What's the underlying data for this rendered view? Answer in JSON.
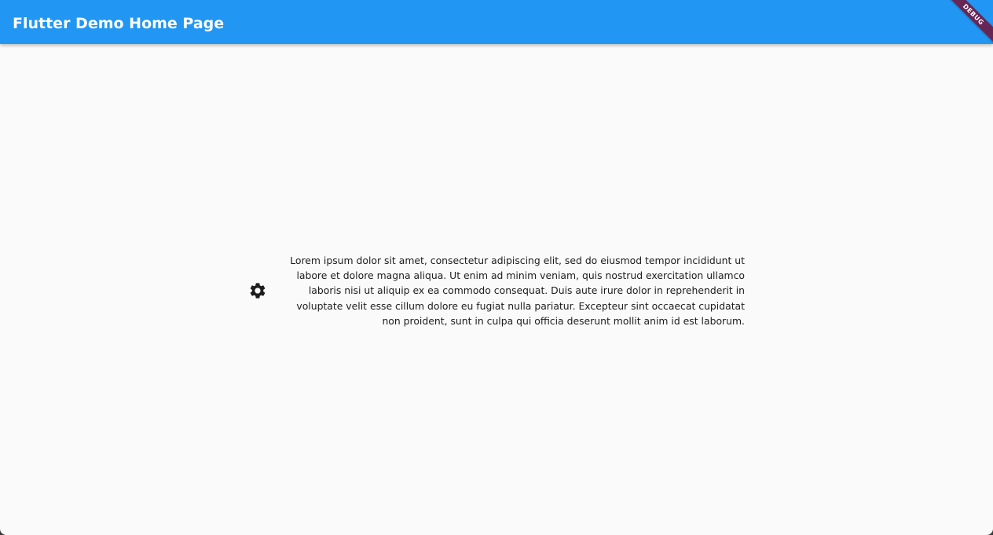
{
  "appbar": {
    "title": "Flutter Demo Home Page",
    "color": "#2196f3"
  },
  "debug_banner": {
    "label": "DEBUG"
  },
  "main": {
    "settings_icon": "gear-icon",
    "body_text": "Lorem ipsum dolor sit amet, consectetur adipiscing elit, sed do eiusmod tempor incididunt ut labore et dolore magna aliqua. Ut enim ad minim veniam, quis nostrud exercitation ullamco laboris nisi ut aliquip ex ea commodo consequat. Duis aute irure dolor in reprehenderit in voluptate velit esse cillum dolore eu fugiat nulla pariatur. Excepteur sint occaecat cupidatat non proident, sunt in culpa qui officia deserunt mollit anim id est laborum."
  }
}
